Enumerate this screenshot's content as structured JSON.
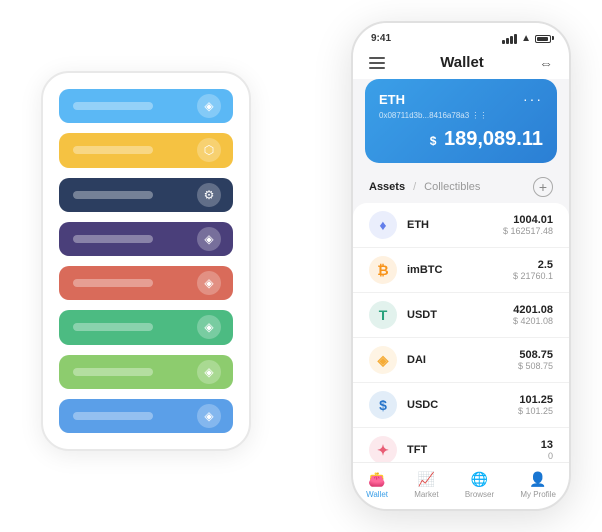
{
  "bgPhone": {
    "cards": [
      {
        "color": "#5BB8F5",
        "iconLetter": "◈"
      },
      {
        "color": "#F5C242",
        "iconLetter": "⬡"
      },
      {
        "color": "#2C3E60",
        "iconLetter": "⚙"
      },
      {
        "color": "#4A3F7A",
        "iconLetter": "◈"
      },
      {
        "color": "#D96B5A",
        "iconLetter": "◈"
      },
      {
        "color": "#4CBB82",
        "iconLetter": "◈"
      },
      {
        "color": "#8DCC6E",
        "iconLetter": "◈"
      },
      {
        "color": "#5B9FE8",
        "iconLetter": "◈"
      }
    ]
  },
  "phone": {
    "statusBar": {
      "time": "9:41",
      "signalLabel": "signal",
      "wifiLabel": "wifi",
      "batteryLabel": "battery"
    },
    "topNav": {
      "menuIcon": "☰",
      "title": "Wallet",
      "expandIcon": "⇔"
    },
    "ethCard": {
      "label": "ETH",
      "dots": "···",
      "address": "0x08711d3b...8416a78a3  ⋮⋮",
      "balancePrefix": "$",
      "balance": " 189,089.11"
    },
    "assetsHeader": {
      "tabActive": "Assets",
      "separator": "/",
      "tabInactive": "Collectibles",
      "addIcon": "+"
    },
    "assets": [
      {
        "name": "ETH",
        "amount": "1004.01",
        "usd": "$ 162517.48",
        "color": "#627EEA",
        "icon": "♦"
      },
      {
        "name": "imBTC",
        "amount": "2.5",
        "usd": "$ 21760.1",
        "color": "#F7931A",
        "icon": "₿"
      },
      {
        "name": "USDT",
        "amount": "4201.08",
        "usd": "$ 4201.08",
        "color": "#26A17B",
        "icon": "T"
      },
      {
        "name": "DAI",
        "amount": "508.75",
        "usd": "$ 508.75",
        "color": "#F5AC37",
        "icon": "◈"
      },
      {
        "name": "USDC",
        "amount": "101.25",
        "usd": "$ 101.25",
        "color": "#2775CA",
        "icon": "$"
      },
      {
        "name": "TFT",
        "amount": "13",
        "usd": "0",
        "color": "#E85D75",
        "icon": "✦"
      }
    ],
    "bottomNav": [
      {
        "label": "Wallet",
        "icon": "👛",
        "active": true
      },
      {
        "label": "Market",
        "icon": "📈",
        "active": false
      },
      {
        "label": "Browser",
        "icon": "🌐",
        "active": false
      },
      {
        "label": "My Profile",
        "icon": "👤",
        "active": false
      }
    ]
  }
}
